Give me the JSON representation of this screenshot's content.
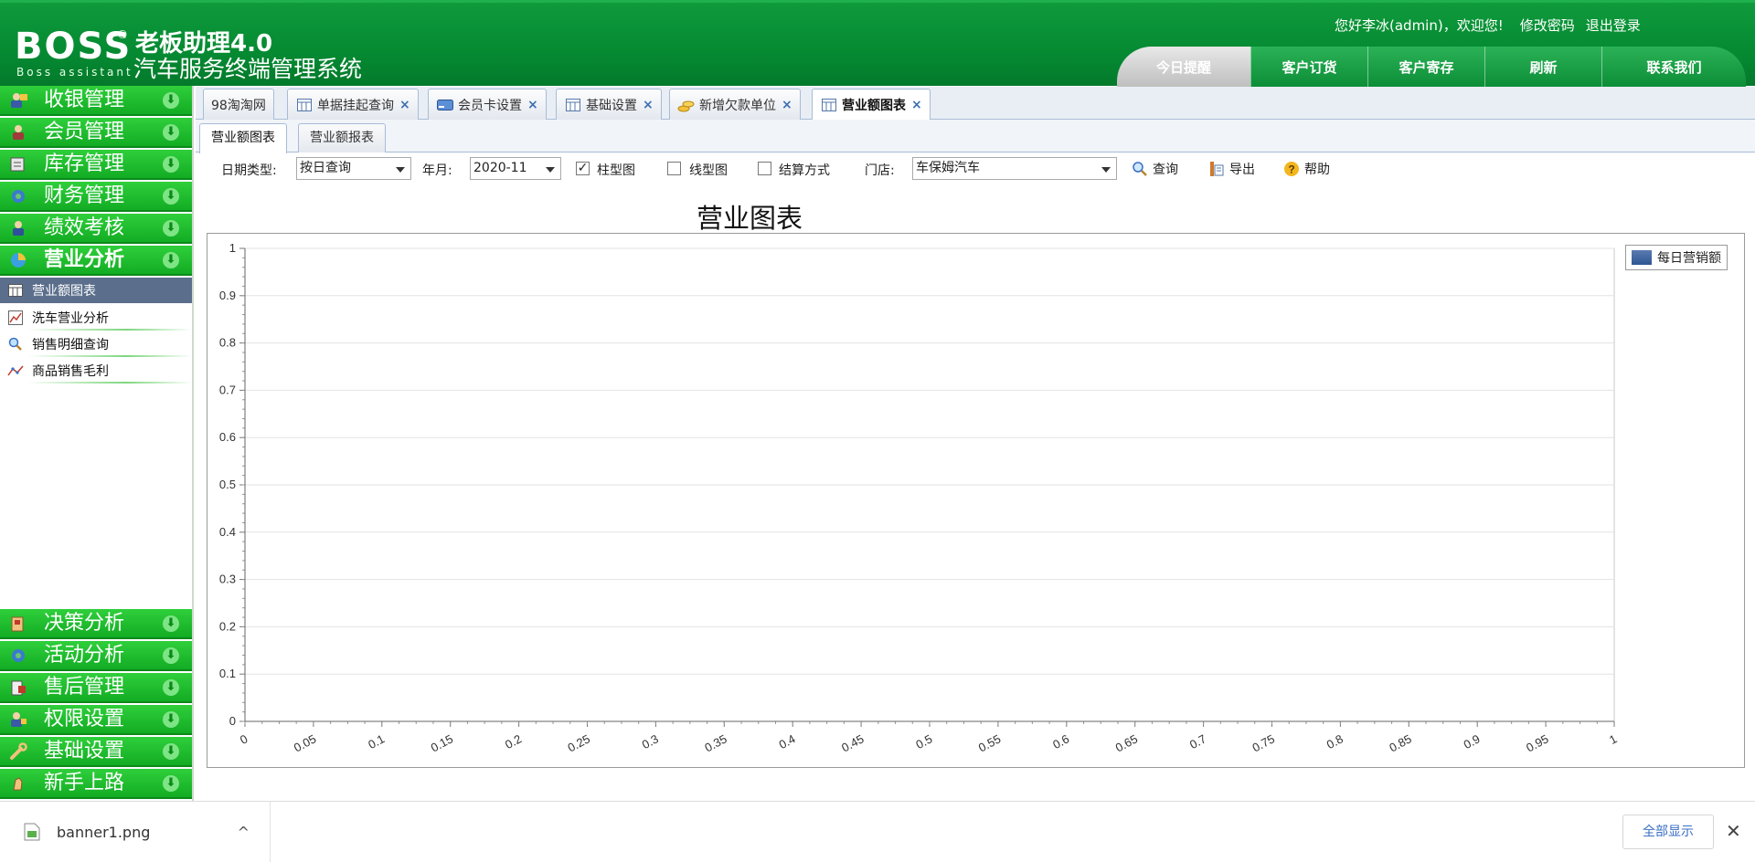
{
  "header": {
    "logo_text": "BOSS",
    "logo_reg": "®",
    "logo_sub": "Boss assistant",
    "product_name": "老板助理4.0",
    "system_name": "汽车服务终端管理系统",
    "greeting": "您好李冰(admin)，欢迎您!",
    "change_password": "修改密码",
    "logout": "退出登录",
    "nav": [
      {
        "label": "今日提醒"
      },
      {
        "label": "客户订货"
      },
      {
        "label": "客户寄存"
      },
      {
        "label": "刷新"
      },
      {
        "label": "联系我们"
      }
    ]
  },
  "sidebar": {
    "menus_top": [
      {
        "label": "收银管理",
        "icon": "cashier-icon"
      },
      {
        "label": "会员管理",
        "icon": "member-icon"
      },
      {
        "label": "库存管理",
        "icon": "inventory-icon"
      },
      {
        "label": "财务管理",
        "icon": "finance-icon"
      },
      {
        "label": "绩效考核",
        "icon": "performance-icon"
      },
      {
        "label": "营业分析",
        "icon": "analysis-icon"
      }
    ],
    "submenu": [
      {
        "label": "营业额图表",
        "icon": "table-icon"
      },
      {
        "label": "洗车营业分析",
        "icon": "chart-icon"
      },
      {
        "label": "销售明细查询",
        "icon": "search-icon"
      },
      {
        "label": "商品销售毛利",
        "icon": "line-chart-icon"
      }
    ],
    "menus_bottom": [
      {
        "label": "决策分析",
        "icon": "decision-icon"
      },
      {
        "label": "活动分析",
        "icon": "activity-icon"
      },
      {
        "label": "售后管理",
        "icon": "aftersale-icon"
      },
      {
        "label": "权限设置",
        "icon": "permission-icon"
      },
      {
        "label": "基础设置",
        "icon": "wrench-icon"
      },
      {
        "label": "新手上路",
        "icon": "guide-icon"
      }
    ],
    "arrow": "⬇"
  },
  "tabs": [
    {
      "label": "98淘淘网"
    },
    {
      "label": "单据挂起查询"
    },
    {
      "label": "会员卡设置"
    },
    {
      "label": "基础设置"
    },
    {
      "label": "新增欠款单位"
    },
    {
      "label": "营业额图表"
    }
  ],
  "tab_close": "×",
  "subtabs": [
    {
      "label": "营业额图表"
    },
    {
      "label": "营业额报表"
    }
  ],
  "toolbar": {
    "date_type_label": "日期类型:",
    "date_type_value": "按日查询",
    "month_label": "年月:",
    "month_value": "2020-11",
    "bar_chart_label": "柱型图",
    "bar_chart_check": "✓",
    "line_chart_label": "线型图",
    "settlement_label": "结算方式",
    "store_label": "门店:",
    "store_value": "车保姆汽车",
    "query_label": "查询",
    "export_label": "导出",
    "help_label": "帮助"
  },
  "chart_data": {
    "type": "bar",
    "title": "营业图表",
    "xlabel": "",
    "ylabel": "",
    "xlim": [
      0,
      1
    ],
    "ylim": [
      0,
      1
    ],
    "x_ticks": [
      "0",
      "0.05",
      "0.1",
      "0.15",
      "0.2",
      "0.25",
      "0.3",
      "0.35",
      "0.4",
      "0.45",
      "0.5",
      "0.55",
      "0.6",
      "0.65",
      "0.7",
      "0.75",
      "0.8",
      "0.85",
      "0.9",
      "0.95",
      "1"
    ],
    "y_ticks": [
      "0",
      "0.1",
      "0.2",
      "0.3",
      "0.4",
      "0.5",
      "0.6",
      "0.7",
      "0.8",
      "0.9",
      "1"
    ],
    "series": [
      {
        "name": "每日营销额",
        "values": [],
        "color": "#3d62a0"
      }
    ],
    "grid": true,
    "legend": "top-right"
  },
  "downloads": {
    "file_name": "banner1.png",
    "chevron": "^",
    "show_all": "全部显示",
    "close": "✕"
  }
}
